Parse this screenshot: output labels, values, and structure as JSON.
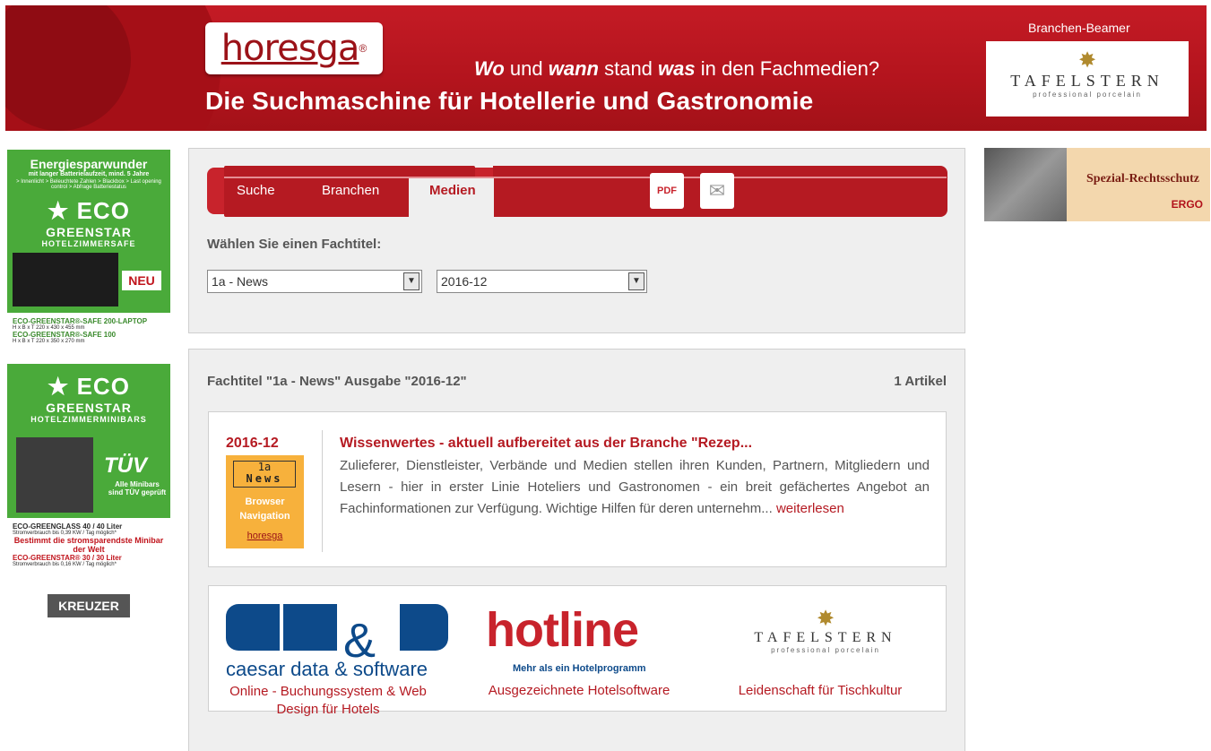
{
  "header": {
    "logo": "horesga",
    "logo_reg": "®",
    "tagline_question_parts": [
      "Wo",
      " und ",
      "wann",
      " stand ",
      "was",
      " in den Fachmedien?"
    ],
    "tagline_main": "Die Suchmaschine für Hotellerie und Gastronomie",
    "beamer_label": "Branchen-Beamer",
    "beamer_brand": "TAFELSTERN",
    "beamer_brand_sub": "professional porcelain"
  },
  "left_ad": {
    "title": "Energiesparwunder",
    "subtitle": "mit langer Batterielaufzeit, mind. 5 Jahre",
    "features": "> Innenlicht > Beleuchtete Zahlen > Blackbox > Last opening control > Abfrage Batteriestatus",
    "eco": "ECO",
    "greenstar": "GREENSTAR",
    "safe_label": "HOTELZIMMERSAFE",
    "neu": "NEU",
    "safe_line1": "ECO-GREENSTAR®-SAFE 200-LAPTOP",
    "safe_line1_dim": "H x B x T 220 x 430 x 455 mm",
    "safe_line2": "ECO-GREENSTAR®-SAFE 100",
    "safe_line2_dim": "H x B x T 220 x 350 x 270 mm",
    "minibar_label": "HOTELZIMMERMINIBARS",
    "tuv": "TÜV",
    "tuv_text": "Alle Minibars sind TÜV geprüft",
    "glass_line": "ECO-GREENGLASS 40 / 40 Liter",
    "glass_sub": "Stromverbrauch bis 0,39 KW / Tag möglich*",
    "red_claim": "Bestimmt die stromsparendste Minibar der Welt",
    "green_line": "ECO-GREENSTAR® 30 / 30 Liter",
    "green_sub": "Stromverbrauch bis 0,16 KW / Tag möglich*",
    "brand": "KREUZER"
  },
  "right_ad": {
    "title": "Spezial-Rechtsschutz",
    "brand": "ERGO"
  },
  "nav": {
    "items": [
      {
        "label": "Suche"
      },
      {
        "label": "Branchen"
      },
      {
        "label": "Medien"
      }
    ],
    "active": "Medien",
    "pdf_icon_label": "PDF"
  },
  "search": {
    "label": "Wählen Sie einen Fachtitel:",
    "title_select": "1a - News",
    "issue_select": "2016-12"
  },
  "results": {
    "heading": "Fachtitel \"1a - News\" Ausgabe \"2016-12\"",
    "count": "1 Artikel",
    "article": {
      "date": "2016-12",
      "thumb_logo_line1": "1a",
      "thumb_logo_line2": "News",
      "thumb_line1": "Browser",
      "thumb_line2": "Navigation",
      "thumb_link": "horesga",
      "title": "Wissenwertes - aktuell aufbereitet aus der Branche \"Rezep...",
      "text": "Zulieferer, Dienstleister, Verbände und Medien stellen ihren Kunden, Partnern, Mitgliedern und Lesern - hier in erster Linie Hoteliers und Gastronomen - ein breit gefächertes Angebot an Fachinformationen zur Verfügung. Wichtige Hilfen für deren unternehm...",
      "more": "weiterlesen"
    }
  },
  "sponsors": [
    {
      "logo": "caesar data & software",
      "amp": "&",
      "caption": "Online - Buchungssystem & Web Design für Hotels"
    },
    {
      "logo": "hotline",
      "logo_sub": "Mehr als ein Hotelprogramm",
      "caption": "Ausgezeichnete Hotelsoftware"
    },
    {
      "logo": "TAFELSTERN",
      "logo_sub": "professional porcelain",
      "caption": "Leidenschaft für Tischkultur"
    }
  ]
}
